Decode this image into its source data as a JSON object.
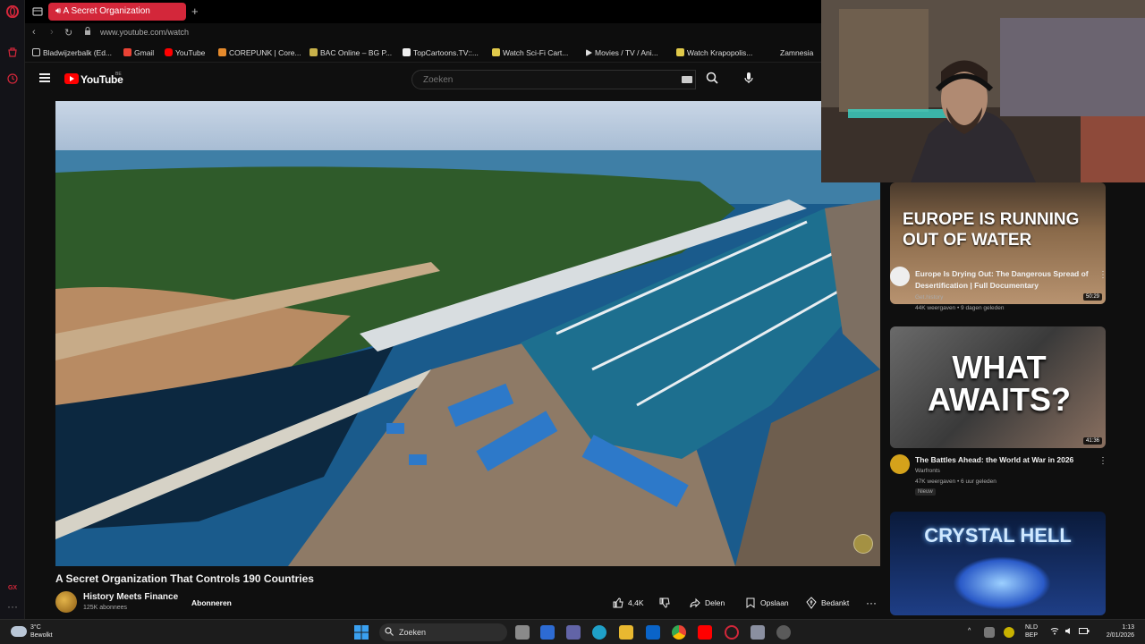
{
  "browser": {
    "active_tab_title": "A Secret Organization",
    "url": "www.youtube.com/watch",
    "bookmarks": [
      "Bladwijzerbalk (Ed...",
      "Gmail",
      "YouTube",
      "COREPUNK | Core...",
      "BAC Online – BG P...",
      "TopCartoons.TV::...",
      "Watch Sci-Fi Cart...",
      "Movies / TV / Ani...",
      "Watch Krapopolis...",
      "Zamnesia"
    ]
  },
  "youtube": {
    "region": "BE",
    "logo_text": "YouTube",
    "search_placeholder": "Zoeken"
  },
  "video": {
    "title": "A Secret Organization That Controls 190 Countries",
    "channel": "History Meets Finance",
    "subscribers": "125K abonnees",
    "subscribe_label": "Abonneren",
    "likes": "4,4K",
    "share_label": "Delen",
    "save_label": "Opslaan",
    "thanks_label": "Bedankt"
  },
  "recommendations": [
    {
      "thumb_text": "EUROPE IS RUNNING OUT OF WATER",
      "duration": "50:29",
      "title": "Europe Is Drying Out: The Dangerous Spread of Desertification | Full Documentary",
      "channel": "Get.history",
      "meta": "44K weergaven • 9 dagen geleden"
    },
    {
      "thumb_text": "WHAT AWAITS?",
      "duration": "41:36",
      "title": "The Battles Ahead: the World at War in 2026",
      "channel": "Warfronts",
      "meta": "47K weergaven • 6 uur geleden",
      "badge": "Nieuw"
    },
    {
      "thumb_text": "CRYSTAL HELL"
    }
  ],
  "taskbar": {
    "weather_temp": "3°C",
    "weather_desc": "Bewolkt",
    "search_label": "Zoeken",
    "lang": "NLD",
    "lang_sub": "BEP",
    "time": "1:13",
    "date": "2/01/2026"
  },
  "colors": {
    "accent": "#d3273a",
    "youtube_red": "#ff0000",
    "background": "#0f0f0f"
  }
}
